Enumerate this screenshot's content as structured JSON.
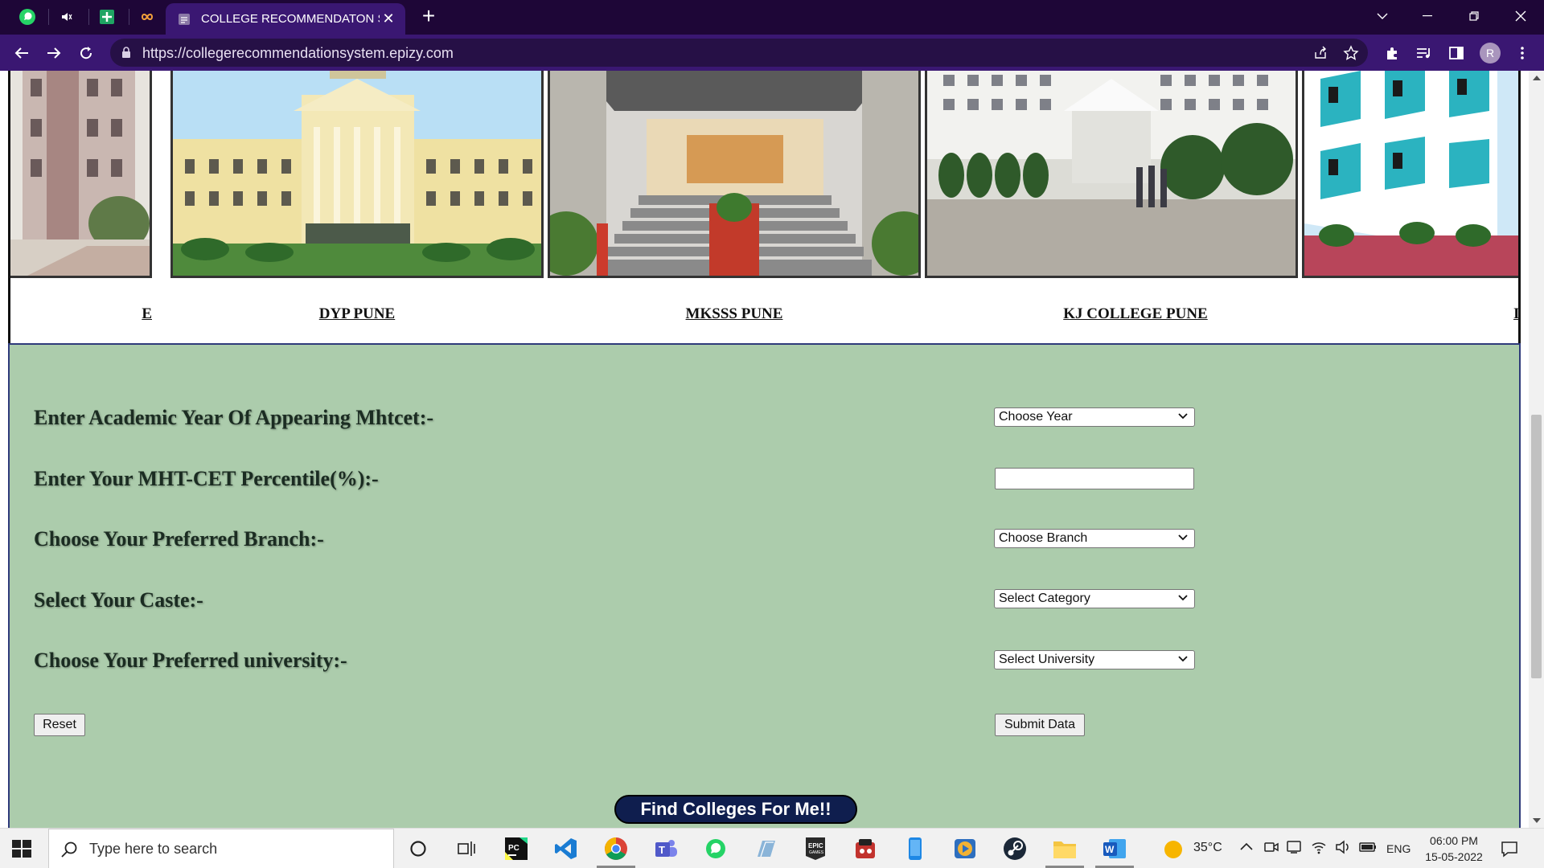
{
  "browser": {
    "tab_title": "COLLEGE RECOMMENDATON SYSTEM",
    "url": "https://collegerecommendationsystem.epizy.com",
    "profile_initial": "R"
  },
  "carousel": {
    "captions": [
      "E",
      "DYP PUNE",
      "MKSSS PUNE",
      "KJ COLLEGE PUNE",
      "I"
    ]
  },
  "form": {
    "year_label": "Enter Academic Year Of Appearing Mhtcet:-",
    "year_select": "Choose Year",
    "percentile_label": "Enter Your MHT-CET Percentile(%):-",
    "percentile_value": "",
    "branch_label": "Choose Your Preferred Branch:-",
    "branch_select": "Choose Branch",
    "caste_label": "Select Your Caste:-",
    "caste_select": "Select Category",
    "university_label": "Choose Your Preferred university:-",
    "university_select": "Select University",
    "reset_button": "Reset",
    "submit_button": "Submit Data",
    "find_button": "Find Colleges For Me!!"
  },
  "taskbar": {
    "search_placeholder": "Type here to search",
    "weather": "35°C",
    "language": "ENG",
    "time": "06:00 PM",
    "date": "15-05-2022"
  },
  "colors": {
    "tab_strip": "#1e0637",
    "toolbar": "#3a1772",
    "form_background": "#acccac",
    "find_button": "#0f1e4e"
  }
}
